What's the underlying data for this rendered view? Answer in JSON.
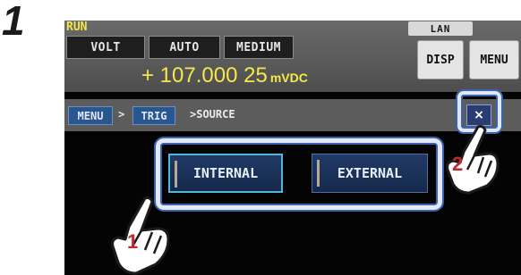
{
  "step": {
    "number": "1"
  },
  "status": {
    "run": "RUN",
    "tabs": [
      "VOLT",
      "AUTO",
      "MEDIUM"
    ],
    "reading_value": "+ 107.000 25",
    "reading_unit": "mVDC",
    "lan": "LAN",
    "disp_button": "DISP",
    "menu_button": "MENU"
  },
  "breadcrumb": {
    "items": [
      "MENU",
      "TRIG"
    ],
    "separator": ">",
    "current": ">SOURCE"
  },
  "close_button": "×",
  "source": {
    "options": [
      "INTERNAL",
      "EXTERNAL"
    ],
    "selected": "INTERNAL"
  },
  "markers": [
    {
      "label": "1",
      "target": "source-options"
    },
    {
      "label": "2",
      "target": "close-button"
    }
  ],
  "colors": {
    "reading": "#f5e94a",
    "run": "#f4e64a",
    "option_button": "#1c3460",
    "highlight_frame": "#3b63b0",
    "marker_number": "#c0262c"
  }
}
